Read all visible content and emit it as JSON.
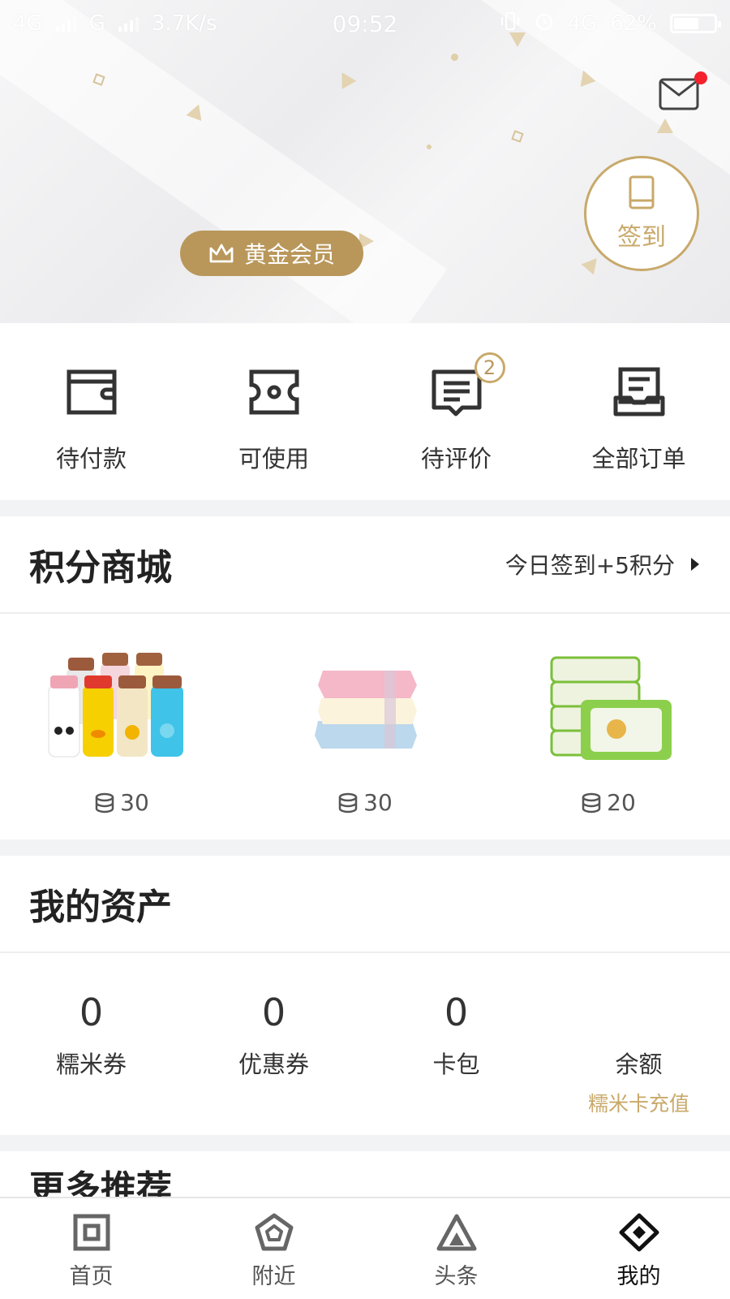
{
  "status_bar": {
    "network_1": "4G",
    "network_2": "G",
    "speed": "3.7K/s",
    "time": "09:52",
    "network_3": "4G",
    "battery": "62%",
    "battery_level": 0.62
  },
  "header": {
    "member_label": "黄金会员",
    "checkin_label": "签到",
    "has_unread_mail": true,
    "accent_color": "#b9975b"
  },
  "orders": [
    {
      "label": "待付款",
      "icon": "wallet-icon",
      "badge": ""
    },
    {
      "label": "可使用",
      "icon": "ticket-icon",
      "badge": ""
    },
    {
      "label": "待评价",
      "icon": "review-icon",
      "badge": "2"
    },
    {
      "label": "全部订单",
      "icon": "order-list-icon",
      "badge": ""
    }
  ],
  "points_mall": {
    "title": "积分商城",
    "link": "今日签到+5积分",
    "products": [
      {
        "image": "thermos-bottles-image",
        "points": "30"
      },
      {
        "image": "towels-image",
        "points": "30"
      },
      {
        "image": "wet-wipes-image",
        "points": "20"
      }
    ]
  },
  "assets": {
    "title": "我的资产",
    "items": [
      {
        "value": "0",
        "label": "糯米券",
        "sub": ""
      },
      {
        "value": "0",
        "label": "优惠券",
        "sub": ""
      },
      {
        "value": "0",
        "label": "卡包",
        "sub": ""
      },
      {
        "value": "",
        "label": "余额",
        "sub": "糯米卡充值"
      }
    ]
  },
  "more": {
    "title": "更多推荐"
  },
  "tabbar": {
    "items": [
      {
        "label": "首页",
        "icon": "home-icon",
        "active": false
      },
      {
        "label": "附近",
        "icon": "nearby-icon",
        "active": false
      },
      {
        "label": "头条",
        "icon": "headline-icon",
        "active": false
      },
      {
        "label": "我的",
        "icon": "profile-icon",
        "active": true
      }
    ]
  }
}
